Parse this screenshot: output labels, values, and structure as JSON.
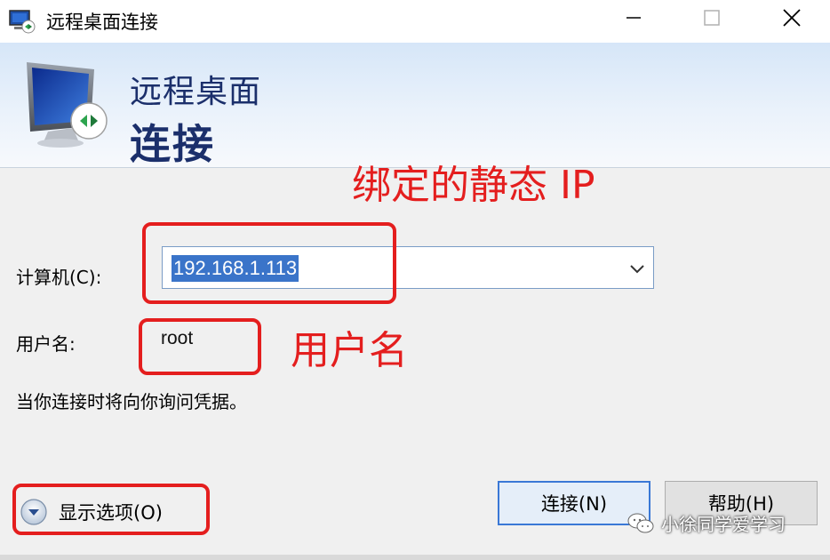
{
  "window": {
    "title": "远程桌面连接",
    "controls": {
      "minimize": "minimize",
      "maximize": "maximize",
      "close": "close"
    }
  },
  "banner": {
    "line1": "远程桌面",
    "line2": "连接"
  },
  "form": {
    "computer_label": "计算机(C):",
    "computer_value": "192.168.1.113",
    "username_label": "用户名:",
    "username_value": "root",
    "hint": "当你连接时将向你询问凭据。"
  },
  "buttons": {
    "show_options": "显示选项(O)",
    "connect": "连接(N)",
    "help": "帮助(H)"
  },
  "annotations": {
    "static_ip": "绑定的静态 IP",
    "username": "用户名",
    "color": "#e41e1e"
  },
  "watermark": {
    "text": "小徐同学爱学习"
  },
  "icons": [
    "remote-desktop-icon",
    "monitor-icon",
    "chevron-down-icon",
    "expand-options-icon",
    "wechat-icon"
  ]
}
